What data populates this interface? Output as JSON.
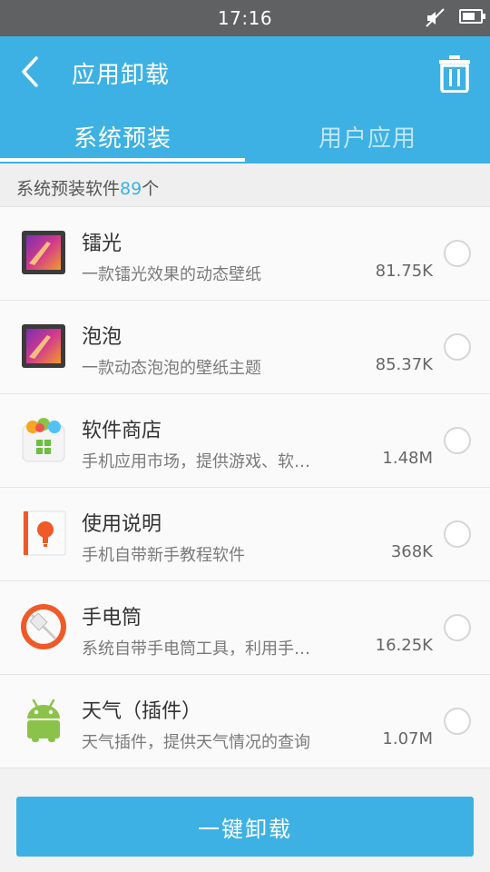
{
  "status_bar": {
    "time": "17:16",
    "mute_icon": "mute-icon",
    "battery_icon": "battery-icon"
  },
  "header": {
    "title": "应用卸载",
    "back_icon": "back-arrow-icon",
    "trash_icon": "trash-icon"
  },
  "tabs": [
    {
      "label": "系统预装",
      "active": true
    },
    {
      "label": "用户应用",
      "active": false
    }
  ],
  "section": {
    "label": "系统预装软件",
    "count": "89",
    "unit": "个"
  },
  "apps": [
    {
      "name": "镭光",
      "desc": "一款镭光效果的动态壁纸",
      "size": "81.75K",
      "icon": "wallpaper-icon",
      "selected": false
    },
    {
      "name": "泡泡",
      "desc": "一款动态泡泡的壁纸主题",
      "size": "85.37K",
      "icon": "wallpaper-icon",
      "selected": false
    },
    {
      "name": "软件商店",
      "desc": "手机应用市场，提供游戏、软…",
      "size": "1.48M",
      "icon": "app-store-icon",
      "selected": false
    },
    {
      "name": "使用说明",
      "desc": "手机自带新手教程软件",
      "size": "368K",
      "icon": "manual-icon",
      "selected": false
    },
    {
      "name": "手电筒",
      "desc": "系统自带手电筒工具，利用手…",
      "size": "16.25K",
      "icon": "flashlight-icon",
      "selected": false
    },
    {
      "name": "天气（插件）",
      "desc": "天气插件，提供天气情况的查询",
      "size": "1.07M",
      "icon": "android-icon",
      "selected": false
    }
  ],
  "footer": {
    "button_label": "一键卸载"
  },
  "colors": {
    "accent": "#3db1e3",
    "status_bar": "#5f6163",
    "background": "#f2f2f2"
  }
}
